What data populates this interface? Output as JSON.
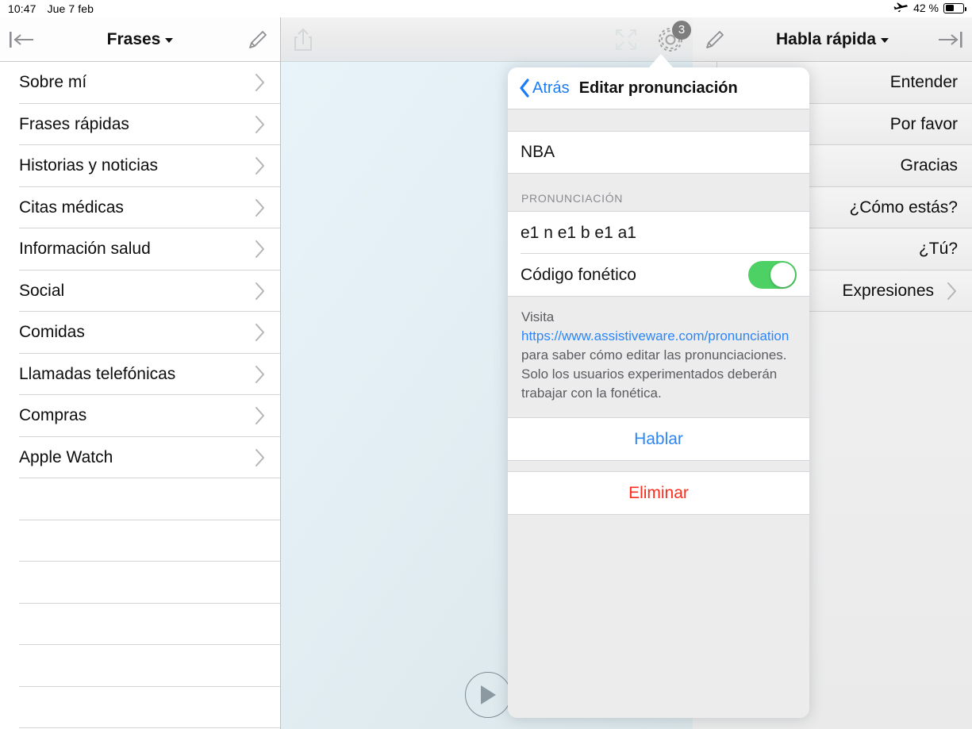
{
  "status_bar": {
    "time": "10:47",
    "date": "Jue 7 feb",
    "airplane_icon": "airplane-icon",
    "battery_percent": "42 %",
    "battery_level": 42
  },
  "left_pane": {
    "toolbar": {
      "collapse_icon": "collapse-left-icon",
      "title": "Frases",
      "caret_icon": "caret-down-icon",
      "edit_icon": "pencil-icon"
    },
    "items": [
      {
        "label": "Sobre mí",
        "chevron": "chevron-right-icon"
      },
      {
        "label": "Frases rápidas",
        "chevron": "chevron-right-icon"
      },
      {
        "label": "Historias y noticias",
        "chevron": "chevron-right-icon"
      },
      {
        "label": "Citas médicas",
        "chevron": "chevron-right-icon"
      },
      {
        "label": "Información salud",
        "chevron": "chevron-right-icon"
      },
      {
        "label": "Social",
        "chevron": "chevron-right-icon"
      },
      {
        "label": "Comidas",
        "chevron": "chevron-right-icon"
      },
      {
        "label": "Llamadas telefónicas",
        "chevron": "chevron-right-icon"
      },
      {
        "label": "Compras",
        "chevron": "chevron-right-icon"
      },
      {
        "label": "Apple Watch",
        "chevron": "chevron-right-icon"
      }
    ],
    "empty_rows": 6
  },
  "center_pane": {
    "toolbar": {
      "share_icon": "share-icon",
      "expand_icon": "expand-fullscreen-icon",
      "settings_icon": "gear-icon",
      "settings_badge": "3"
    },
    "play_icon": "play-icon",
    "background_top": "#e9f4fa",
    "background_bottom": "#dbe6e9"
  },
  "right_pane": {
    "toolbar": {
      "edit_icon": "pencil-icon",
      "title": "Habla rápida",
      "caret_icon": "caret-down-icon",
      "collapse_icon": "collapse-right-icon"
    },
    "items": [
      {
        "label": "Entender",
        "chevron": ""
      },
      {
        "label": "Por favor",
        "chevron": ""
      },
      {
        "label": "Gracias",
        "chevron": ""
      },
      {
        "label": "¿Cómo estás?",
        "chevron": ""
      },
      {
        "label": "¿Tú?",
        "chevron": ""
      },
      {
        "label": "Expresiones",
        "chevron": "chevron-right-icon"
      }
    ]
  },
  "popover": {
    "back_label": "Atrás",
    "back_icon": "chevron-left-icon",
    "title": "Editar pronunciación",
    "word_value": "NBA",
    "section_header": "PRONUNCIACIÓN",
    "phonetic_value": "e1 n e1 b e1 a1",
    "toggle_label": "Código fonético",
    "toggle_on": true,
    "toggle_color": "#4ed164",
    "help_prefix": "Visita ",
    "help_link": "https://www.assistiveware.com/pronunciation",
    "help_suffix": " para saber cómo editar las pronunciaciones.",
    "help_line2": "Solo los usuarios experimentados deberán trabajar con la fonética.",
    "speak_label": "Hablar",
    "delete_label": "Eliminar",
    "accent_color": "#2d86f7",
    "danger_color": "#fb2c1d"
  }
}
